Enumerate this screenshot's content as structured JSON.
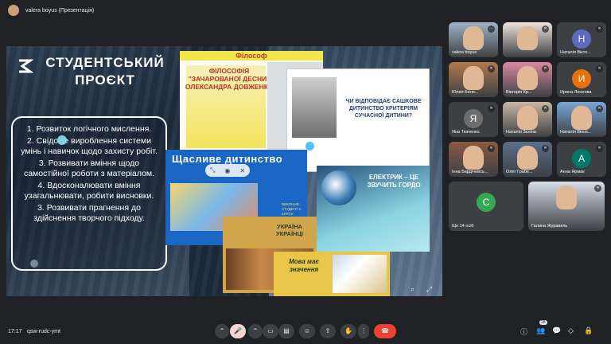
{
  "window": {
    "title": "valera boyus (Презентація)"
  },
  "slide": {
    "title": "СТУДЕНТСЬКИЙ ПРОЄКТ",
    "goals": [
      "1. Розвиток логічного мислення.",
      "2. Свідоме вироблення системи умінь і навичок щодо захисту робіт.",
      "3. Розвивати вміння щодо самостійної роботи з матеріалом.",
      "4. Вдосконалювати вміння узагальнювати, робити висновки.",
      "3. Розвивати прагнення до здійснення творчого підходу."
    ],
    "card_philo_header": "Філософ",
    "card_philo_title": "ФІЛОСОФІЯ \"ЗАЧАРОВАНОЇ ДЕСНИ\" ОЛЕКСАНДРА ДОВЖЕНКА",
    "card_child_question": "ЧИ ВІДПОВІДАЄ САШКОВЕ ДИТИНСТВО КРИТЕРІЯМ СУЧАСНОЇ ДИТИНИ?",
    "card_happy_title": "Щасливе дитинство",
    "card_happy_exec": "ВИКОНАВ: СТУДЕНТ 2 КУРСУ",
    "card_electric_title": "ЕЛЕКТРИК – ЦЕ ЗВУЧИТЬ ГОРДО",
    "card_ukr_title": "УКРАЇНА УКРАЇНЦІ",
    "card_mova_title": "Мова має значення"
  },
  "participants": [
    {
      "name": "valera boyus",
      "kind": "photo",
      "color": "#9fb3c8",
      "mic": "more"
    },
    {
      "name": "",
      "kind": "photo",
      "color": "#f0e2dc",
      "mic": "off"
    },
    {
      "name": "Наталія Вікто...",
      "kind": "letter",
      "letter": "Н",
      "color": "#5c6bc0",
      "mic": "off"
    },
    {
      "name": "Юлия Беля...",
      "kind": "photo",
      "color": "#b07a4f",
      "mic": "off"
    },
    {
      "name": "Вікторія Кр...",
      "kind": "photo",
      "color": "#d98aa0",
      "mic": "off"
    },
    {
      "name": "Ирина Леонова",
      "kind": "letter",
      "letter": "И",
      "color": "#e8710a",
      "mic": "off"
    },
    {
      "name": "Яна Ткаченко",
      "kind": "letter",
      "letter": "Я",
      "color": "#6d6d6d",
      "mic": "off"
    },
    {
      "name": "Наталія Зєніна",
      "kind": "photo",
      "color": "#c9b7a3",
      "mic": "off"
    },
    {
      "name": "Наталія Вінок...",
      "kind": "photo",
      "color": "#7aa6d8",
      "mic": "off"
    },
    {
      "name": "Інна Бардічевсь...",
      "kind": "photo",
      "color": "#8a5a44",
      "mic": "off"
    },
    {
      "name": "Олег Грабе...",
      "kind": "photo",
      "color": "#5a6f8a",
      "mic": "off"
    },
    {
      "name": "Анна Ярмак",
      "kind": "letter",
      "letter": "А",
      "color": "#00796b",
      "mic": "off"
    },
    {
      "name": "Ще 14 осіб",
      "kind": "more",
      "letter": "С",
      "color": "#34a853",
      "mic": ""
    },
    {
      "name": "Галина Журавель",
      "kind": "photo",
      "color": "#d7dde5",
      "mic": "off"
    }
  ],
  "bottom": {
    "time": "17:17",
    "meeting_code": "qsw-rudc-ymt",
    "people_count": "28"
  },
  "icons": {
    "camera": "camera-icon",
    "mic": "mic-off-icon",
    "captions": "captions-icon",
    "emoji": "emoji-icon",
    "present": "present-icon",
    "hand": "raise-hand-icon",
    "more": "more-icon",
    "end": "end-call-icon"
  },
  "colors": {
    "background": "#202124",
    "end_call": "#ea4335",
    "tile": "#3c4043"
  }
}
